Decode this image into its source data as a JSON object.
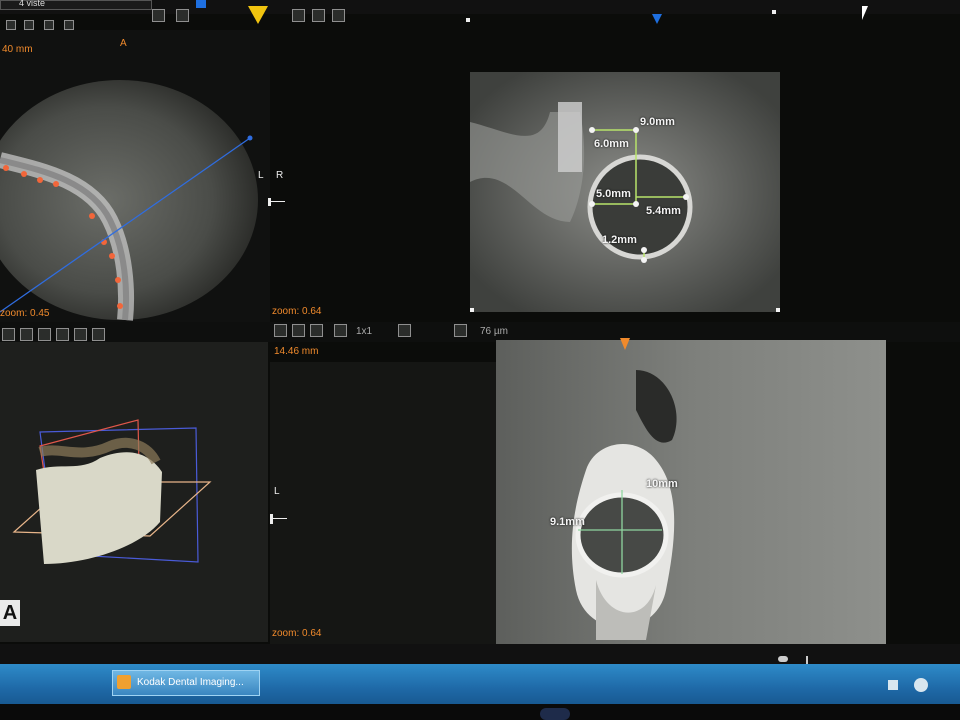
{
  "top_bar": {
    "views_label": "4 viste"
  },
  "viewport_axial": {
    "letter_a": "A",
    "left_mm": "40 mm",
    "zoom": "zoom: 0.45",
    "orientation_l": "L",
    "orientation_r": "R"
  },
  "viewport_cross_section": {
    "measurements": [
      "9.0mm",
      "6.0mm",
      "5.0mm",
      "5.4mm",
      "1.2mm"
    ]
  },
  "viewport_3d": {
    "letter": "A"
  },
  "viewport_panoramic": {
    "zoom_top": "zoom: 0.64",
    "distance": "14.46 mm",
    "layout": "1x1",
    "resolution": "76 µm",
    "orientation_l": "L",
    "zoom_bottom": "zoom: 0.64"
  },
  "viewport_sagittal": {
    "measurements": [
      "9.1mm",
      "10mm"
    ]
  },
  "taskbar": {
    "app_label": "Kodak Dental Imaging..."
  },
  "colors": {
    "orange_accent": "#f08a2c",
    "measure_green": "#b7e36a",
    "taskbar_blue": "#1f6aa8",
    "blue_marker": "#1e6fe0",
    "yellow_marker": "#f1c40f"
  }
}
